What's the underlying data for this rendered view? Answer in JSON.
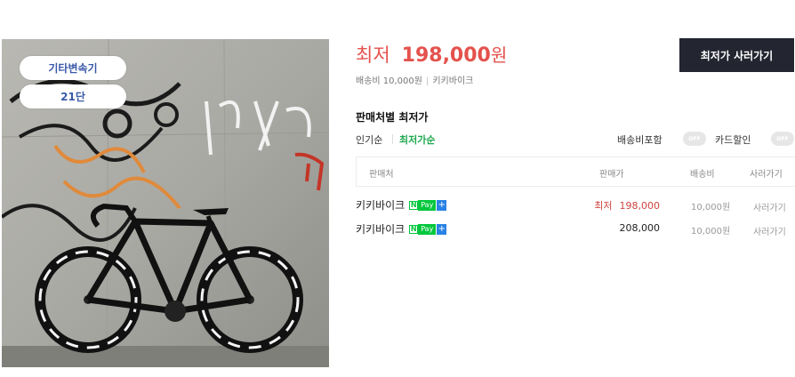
{
  "product": {
    "tags": [
      "기타변속기",
      "21단"
    ]
  },
  "summary": {
    "price_label": "최저",
    "price_value": "198,000",
    "price_unit": "원",
    "shipping": "배송비 10,000원",
    "seller": "키키바이크",
    "buy_button": "최저가 사러가기"
  },
  "sellers_section": {
    "title": "판매처별 최저가",
    "sort_popular": "인기순",
    "sort_lowest": "최저가순",
    "toggle_shipping_label": "배송비포함",
    "toggle_card_label": "카드할인",
    "toggle_state": "OFF",
    "columns": {
      "shop": "판매처",
      "price": "판매가",
      "shipping": "배송비",
      "buy": "사러가기"
    },
    "rows": [
      {
        "shop": "키키바이크",
        "price_label": "최저",
        "price": "198,000",
        "shipping": "10,000원",
        "buy": "사러가기"
      },
      {
        "shop": "키키바이크",
        "price_label": "",
        "price": "208,000",
        "shipping": "10,000원",
        "buy": "사러가기"
      }
    ],
    "npay": {
      "n": "N",
      "pay": "Pay",
      "plus": "+"
    }
  },
  "colors": {
    "accent_red": "#e4524d",
    "accent_green": "#1fa84f",
    "button_dark": "#232530",
    "npay_green": "#00c73c"
  }
}
